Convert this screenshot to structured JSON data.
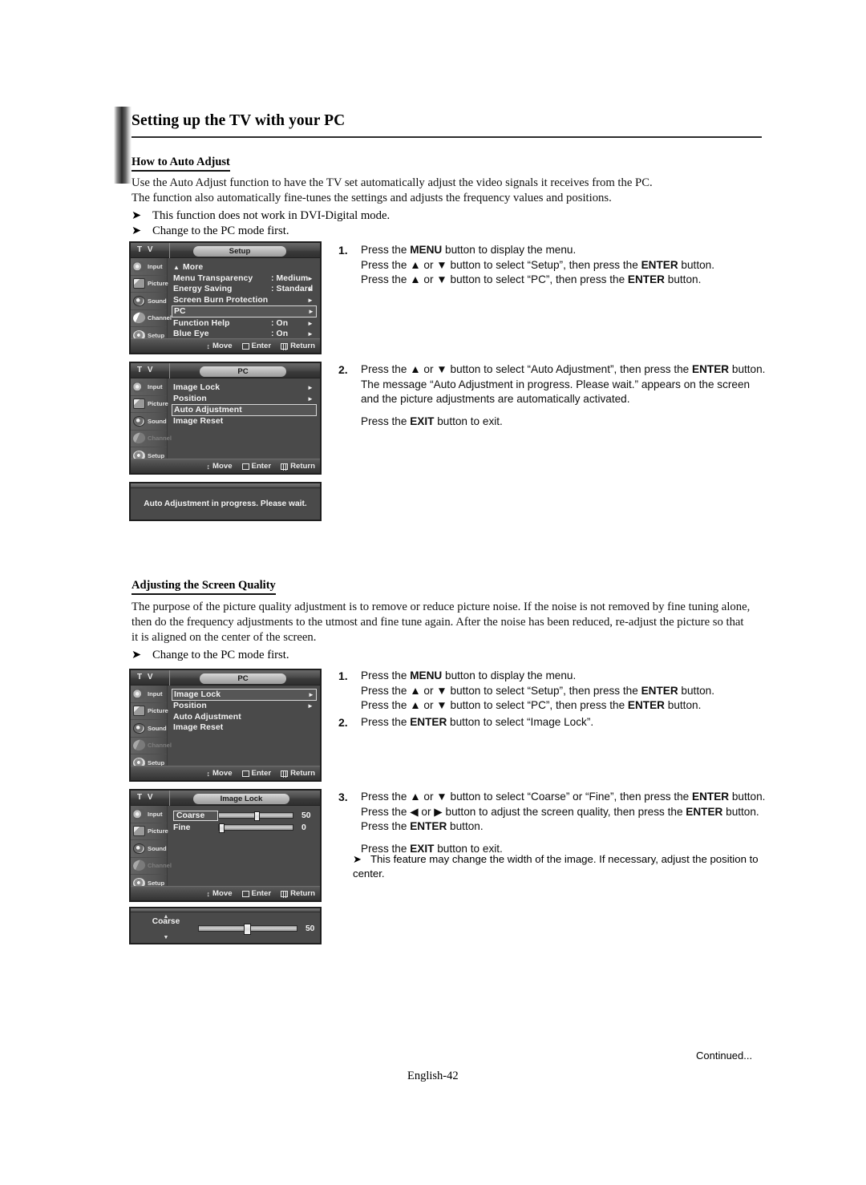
{
  "page": {
    "title": "Setting up the TV with your PC",
    "footer_continued": "Continued...",
    "footer_page": "English-42"
  },
  "sections": {
    "auto_adjust": {
      "heading": "How to Auto Adjust",
      "paragraph_line1": "Use the Auto Adjust function to have the TV set automatically adjust the video signals it receives from the PC.",
      "paragraph_line2": "The function also automatically fine-tunes the settings and adjusts the frequency values and positions.",
      "bullets": [
        "This function does not work in DVI-Digital mode.",
        "Change to the PC mode first."
      ],
      "steps": [
        {
          "num": "1.",
          "lines": [
            "Press the MENU button to display the menu.",
            "Press the ▲ or ▼ button to select “Setup”, then press the ENTER button.",
            "Press the ▲ or ▼ button to select “PC”, then press the ENTER button."
          ]
        },
        {
          "num": "2.",
          "lines": [
            "Press the ▲ or ▼ button to select “Auto Adjustment”, then press the ENTER button.",
            "The message “Auto Adjustment in progress. Please wait.” appears on the screen",
            "and the picture adjustments are automatically activated."
          ],
          "extra": "Press the EXIT button to exit."
        }
      ]
    },
    "screen_quality": {
      "heading": "Adjusting the Screen Quality",
      "paragraph_line1": "The purpose of the picture quality adjustment is to remove or reduce picture noise. If the noise is not removed by fine tuning alone,",
      "paragraph_line2": "then do the frequency adjustments to the utmost and fine tune again. After the noise has been reduced, re-adjust the picture so that",
      "paragraph_line3": "it is aligned on the center of the screen.",
      "bullets": [
        "Change to the PC mode first."
      ],
      "steps": [
        {
          "num": "1.",
          "lines": [
            "Press the MENU button to display the menu.",
            "Press the ▲ or ▼ button to select “Setup”, then press the ENTER button.",
            "Press the ▲ or ▼ button to select “PC”, then press the ENTER button."
          ]
        },
        {
          "num": "2.",
          "lines": [
            "Press the ENTER button to select “Image Lock”."
          ]
        },
        {
          "num": "3.",
          "lines": [
            "Press the ▲ or ▼ button to select “Coarse” or “Fine”, then press the ENTER button.",
            "Press the ◀ or ▶ button to adjust the screen quality, then press the ENTER button.",
            "Press the ENTER button."
          ],
          "extra": "Press the EXIT button to exit."
        }
      ],
      "note": "This feature may change the width of the image. If necessary, adjust the position to center."
    }
  },
  "osd_common": {
    "source_label": "T V",
    "sidebar": [
      {
        "label": "Input",
        "icon": "input-icon"
      },
      {
        "label": "Picture",
        "icon": "picture-icon"
      },
      {
        "label": "Sound",
        "icon": "sound-icon"
      },
      {
        "label": "Channel",
        "icon": "channel-icon"
      },
      {
        "label": "Setup",
        "icon": "setup-icon"
      }
    ],
    "footer": {
      "move": "Move",
      "enter": "Enter",
      "return": "Return"
    }
  },
  "osd_setup": {
    "title": "Setup",
    "rows": [
      {
        "label": "More",
        "value": "",
        "caret": false,
        "selected": false,
        "up": true
      },
      {
        "label": "Menu Transparency",
        "value": ": Medium",
        "caret": true,
        "selected": false
      },
      {
        "label": "Energy Saving",
        "value": ": Standard",
        "caret": true,
        "selected": false
      },
      {
        "label": "Screen Burn Protection",
        "value": "",
        "caret": true,
        "selected": false
      },
      {
        "label": "PC",
        "value": "",
        "caret": true,
        "selected": true
      },
      {
        "label": "Function Help",
        "value": ": On",
        "caret": true,
        "selected": false
      },
      {
        "label": "Blue Eye",
        "value": ": On",
        "caret": true,
        "selected": false
      }
    ],
    "active_sidebar": "Setup"
  },
  "osd_pc_auto": {
    "title": "PC",
    "rows": [
      {
        "label": "Image Lock",
        "caret": true,
        "selected": false
      },
      {
        "label": "Position",
        "caret": true,
        "selected": false
      },
      {
        "label": "Auto Adjustment",
        "caret": false,
        "selected": true
      },
      {
        "label": "Image Reset",
        "caret": false,
        "selected": false
      }
    ],
    "dimmed_sidebar": [
      "Channel"
    ]
  },
  "osd_pc_lock": {
    "title": "PC",
    "rows": [
      {
        "label": "Image Lock",
        "caret": true,
        "selected": true
      },
      {
        "label": "Position",
        "caret": true,
        "selected": false
      },
      {
        "label": "Auto Adjustment",
        "caret": false,
        "selected": false
      },
      {
        "label": "Image Reset",
        "caret": false,
        "selected": false
      }
    ],
    "dimmed_sidebar": [
      "Channel"
    ]
  },
  "osd_image_lock": {
    "title": "Image Lock",
    "sliders": [
      {
        "label": "Coarse",
        "value": "50",
        "percent": 50,
        "selected": true
      },
      {
        "label": "Fine",
        "value": "0",
        "percent": 0,
        "selected": false
      }
    ],
    "dimmed_sidebar": [
      "Channel"
    ]
  },
  "osd_message": {
    "text": "Auto Adjustment in progress. Please wait."
  },
  "osd_coarse_bar": {
    "label": "Coarse",
    "value": "50",
    "percent": 50,
    "up_arrow": "▲",
    "down_arrow": "▼"
  }
}
